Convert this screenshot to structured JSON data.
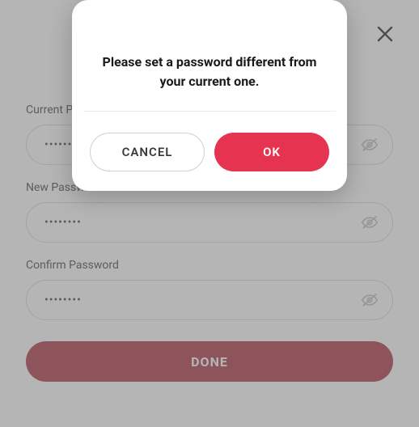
{
  "form": {
    "current": {
      "label": "Current Password",
      "value": "••••••••"
    },
    "new": {
      "label": "New Password",
      "value": "••••••••"
    },
    "confirm": {
      "label": "Confirm Password",
      "value": "••••••••"
    },
    "done_label": "DONE"
  },
  "modal": {
    "message": "Please set a password different from your current one.",
    "cancel_label": "CANCEL",
    "ok_label": "OK"
  }
}
